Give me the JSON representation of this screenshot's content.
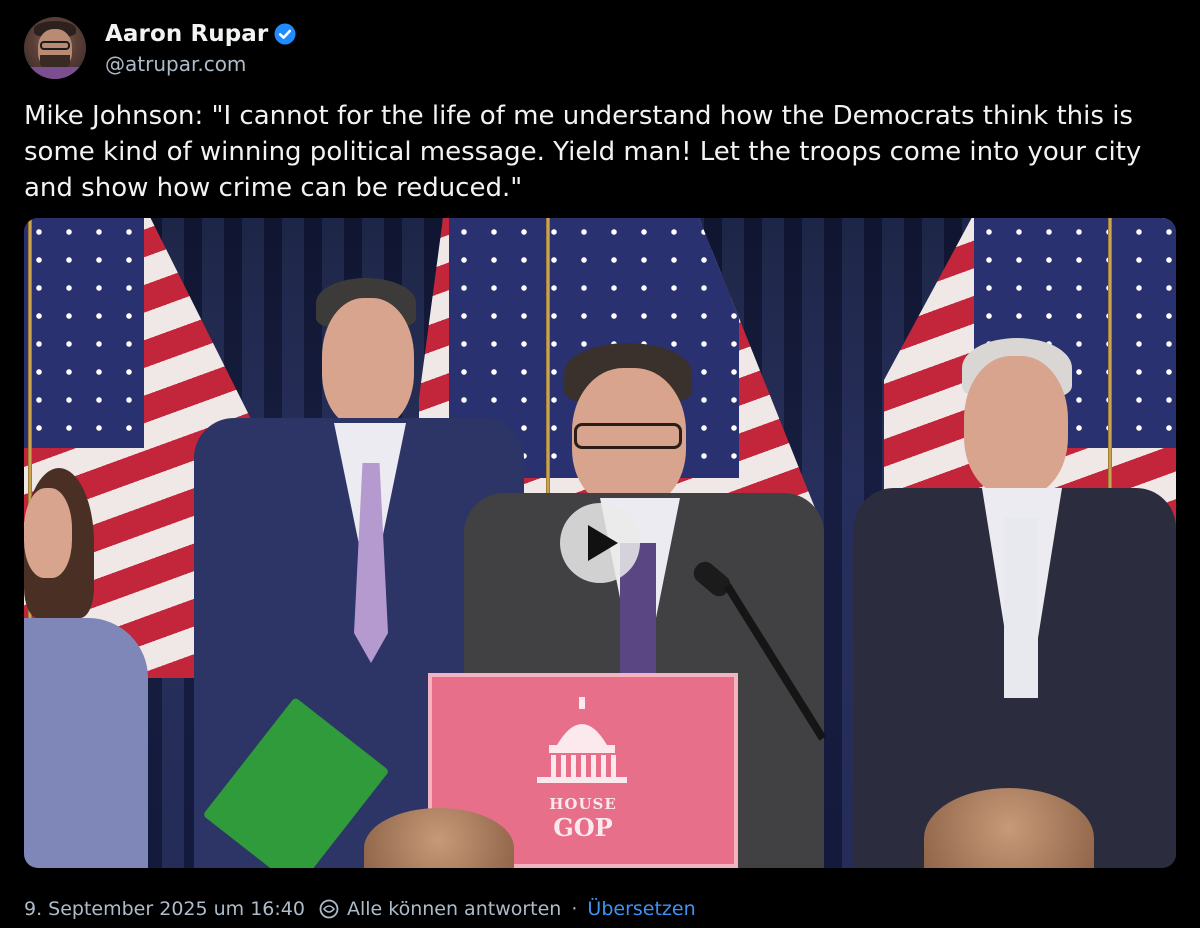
{
  "author": {
    "display_name": "Aaron Rupar",
    "handle": "@atrupar.com",
    "verified": true,
    "verified_color": "#208bfe"
  },
  "post": {
    "text": "Mike Johnson: \"I cannot for the life of me understand how the Democrats think this is some kind of winning political message. Yield man! Let the troops come into your city and show how crime can be reduced.\""
  },
  "video": {
    "podium_sign": {
      "line1": "HOUSE",
      "line2": "GOP"
    }
  },
  "footer": {
    "timestamp": "9. September 2025 um 16:40",
    "reply_setting": "Alle können antworten",
    "separator": "·",
    "translate_label": "Übersetzen"
  },
  "colors": {
    "background": "#000000",
    "text": "#f1f3f5",
    "muted": "#aebbc9",
    "link": "#3d93f5"
  }
}
